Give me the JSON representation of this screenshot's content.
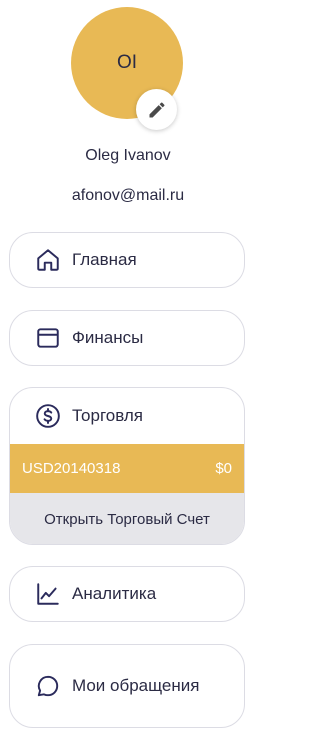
{
  "profile": {
    "initials": "OI",
    "name": "Oleg Ivanov",
    "email": "afonov@mail.ru"
  },
  "colors": {
    "accent": "#e8b955",
    "text": "#2b2b44",
    "border": "#dcdce4",
    "muted_bg": "#e6e6ea"
  },
  "nav": {
    "home": {
      "label": "Главная",
      "icon": "home-icon"
    },
    "finance": {
      "label": "Финансы",
      "icon": "wallet-icon"
    },
    "trading": {
      "label": "Торговля",
      "icon": "dollar-circle-icon",
      "account": {
        "id": "USD20140318",
        "balance": "$0"
      },
      "open_account_label": "Открыть Торговый Счет"
    },
    "analytics": {
      "label": "Аналитика",
      "icon": "chart-line-icon"
    },
    "support": {
      "label": "Мои обращения",
      "icon": "chat-bubble-icon"
    }
  }
}
